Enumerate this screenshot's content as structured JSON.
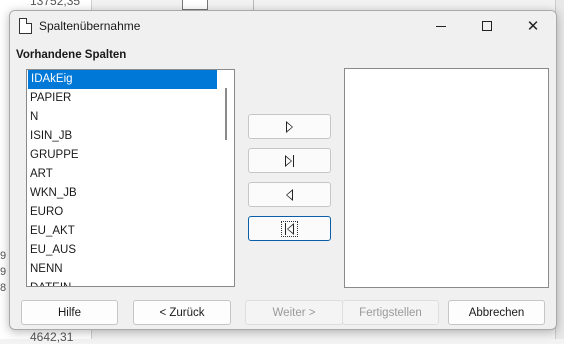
{
  "background": {
    "top_value": "13752,35",
    "bottom_value": "4642,31",
    "left_digits": [
      "9",
      "9",
      "8"
    ]
  },
  "dialog": {
    "title": "Spaltenübernahme",
    "window_controls": {
      "minimize": "minimize-icon",
      "maximize": "maximize-icon",
      "close": "close-icon"
    },
    "section_label": "Vorhandene Spalten",
    "available_columns": [
      "IDAkEig",
      "PAPIER",
      "N",
      "ISIN_JB",
      "GRUPPE",
      "ART",
      "WKN_JB",
      "EURO",
      "EU_AKT",
      "EU_AUS",
      "NENN",
      "DATEIN"
    ],
    "selected_column": "IDAkEig",
    "target_columns": [],
    "move_buttons": [
      {
        "name": "move-selected-right",
        "icon": "triangle-right-icon"
      },
      {
        "name": "move-all-right",
        "icon": "triangle-right-bar-icon"
      },
      {
        "name": "move-selected-left",
        "icon": "triangle-left-icon"
      },
      {
        "name": "move-all-left",
        "icon": "bar-triangle-left-icon"
      }
    ],
    "footer": {
      "help": "Hilfe",
      "back": "< Zurück",
      "next": "Weiter >",
      "finish": "Fertigstellen",
      "cancel": "Abbrechen"
    },
    "colors": {
      "selection": "#0078d7",
      "focus_border": "#0a5ea8"
    }
  }
}
